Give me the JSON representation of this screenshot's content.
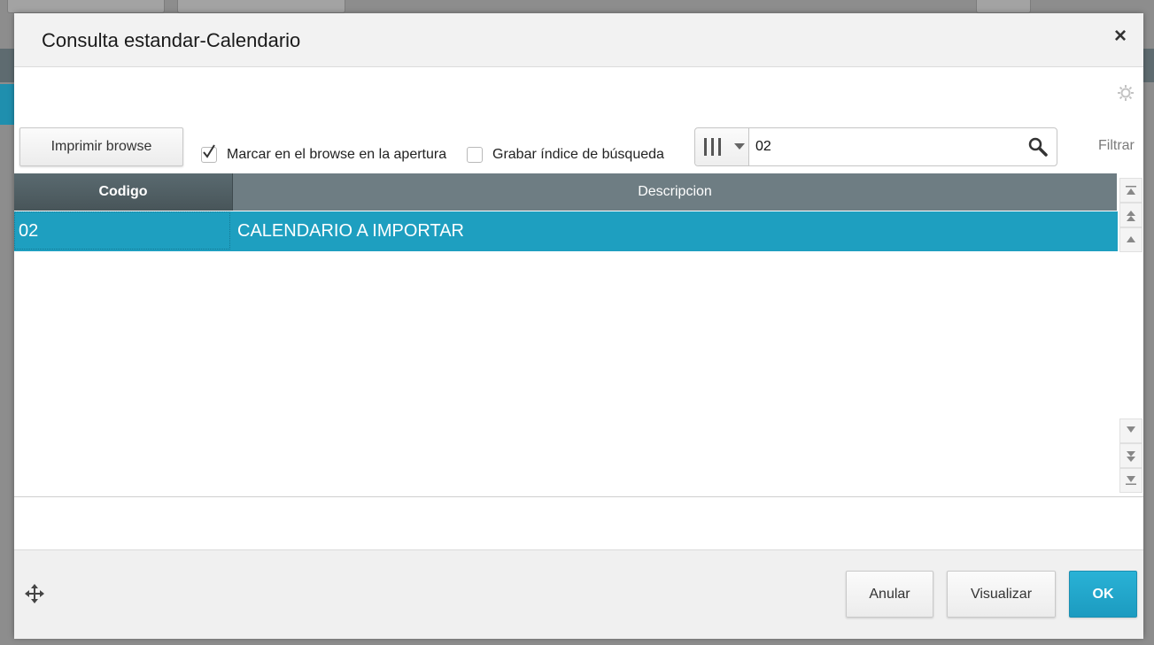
{
  "dialog": {
    "title": "Consulta estandar-Calendario",
    "close_label": "×"
  },
  "toolbar": {
    "print_button": "Imprimir browse",
    "mark_checkbox": {
      "label": "Marcar en el browse en la apertura",
      "checked": true
    },
    "save_index_checkbox": {
      "label": "Grabar índice de búsqueda",
      "checked": false
    },
    "search": {
      "value": "02"
    },
    "filter_label": "Filtrar"
  },
  "grid": {
    "columns": [
      "Codigo",
      "Descripcion"
    ],
    "rows": [
      {
        "codigo": "02",
        "descripcion": "CALENDARIO A IMPORTAR"
      }
    ]
  },
  "footer": {
    "cancel_button": "Anular",
    "view_button": "Visualizar",
    "ok_button": "OK"
  },
  "colors": {
    "selected_row": "#1e9fc0",
    "header_dark": "#485559",
    "header": "#6e7d83",
    "ok_button": "#1c9bc0"
  },
  "icons": [
    "close-icon",
    "gear-icon",
    "checkbox-check-icon",
    "column-index-icon",
    "chevron-down-icon",
    "search-icon",
    "scroll-top-icon",
    "scroll-page-up-icon",
    "scroll-up-icon",
    "scroll-down-icon",
    "scroll-page-down-icon",
    "scroll-bottom-icon",
    "move-icon"
  ]
}
